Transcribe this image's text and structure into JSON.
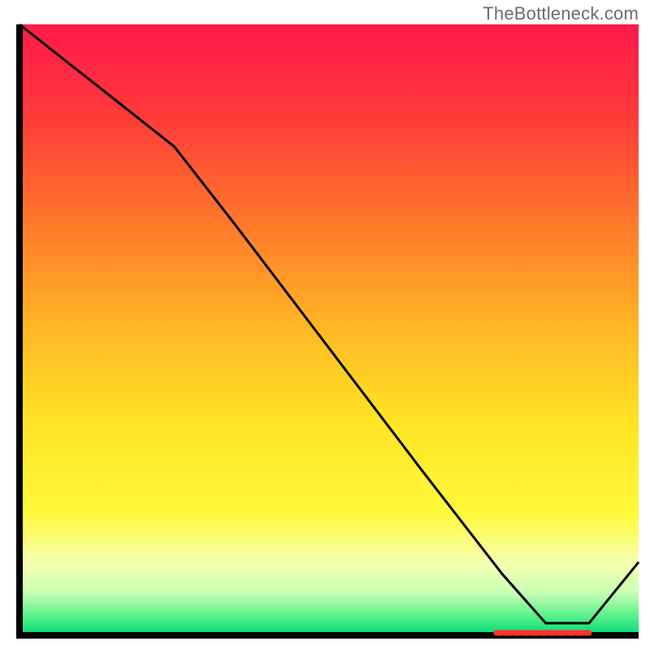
{
  "watermark": "TheBottleneck.com",
  "chart_data": {
    "type": "line",
    "title": "",
    "xlabel": "",
    "ylabel": "",
    "xlim": [
      0,
      100
    ],
    "ylim": [
      0,
      100
    ],
    "grid": false,
    "legend": false,
    "series": [
      {
        "name": "bottleneck-curve",
        "x": [
          0,
          10,
          25,
          35,
          50,
          65,
          78,
          85,
          92,
          100
        ],
        "y": [
          100,
          92,
          80,
          67,
          47,
          27,
          10,
          2,
          2,
          12
        ]
      }
    ],
    "annotations": [
      {
        "name": "optimal-segment",
        "x_start": 77,
        "x_end": 92,
        "y": 0
      }
    ],
    "background": {
      "type": "vertical-gradient",
      "stops": [
        {
          "offset": 0.0,
          "color": "#ff1a4b"
        },
        {
          "offset": 0.15,
          "color": "#ff3a3a"
        },
        {
          "offset": 0.33,
          "color": "#ff7a2a"
        },
        {
          "offset": 0.5,
          "color": "#ffb824"
        },
        {
          "offset": 0.65,
          "color": "#ffe324"
        },
        {
          "offset": 0.8,
          "color": "#fff93a"
        },
        {
          "offset": 0.88,
          "color": "#f7ffb0"
        },
        {
          "offset": 0.93,
          "color": "#c9ffb3"
        },
        {
          "offset": 0.97,
          "color": "#54f08a"
        },
        {
          "offset": 1.0,
          "color": "#00d774"
        }
      ]
    },
    "axes_color": "#000000",
    "line_color": "#000000",
    "annotation_color": "#ff3030"
  }
}
